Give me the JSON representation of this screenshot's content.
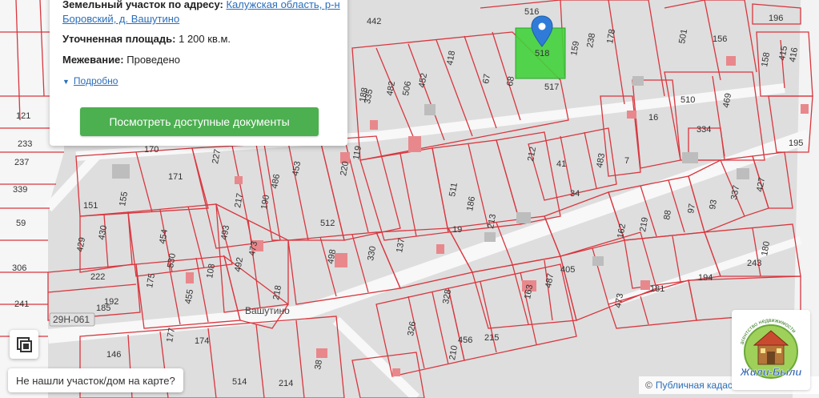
{
  "info": {
    "address_label": "Земельный участок по адресу:",
    "address_line1": "Калужская область, р-н",
    "address_line2": "Боровский, д. Вашутино",
    "area_label": "Уточненная площадь:",
    "area_value": "1 200 кв.м.",
    "survey_label": "Межевание:",
    "survey_value": "Проведено",
    "details_link": "Подробно",
    "docs_button": "Посмотреть доступные документы"
  },
  "map": {
    "selected_plot": "518",
    "road_code": "29Н-061",
    "village_label": "Вашутино",
    "plots": [
      "516",
      "442",
      "196",
      "159",
      "178",
      "238",
      "501",
      "156",
      "415",
      "158",
      "416",
      "67",
      "68",
      "517",
      "418",
      "452",
      "482",
      "506",
      "188",
      "335",
      "121",
      "233",
      "237",
      "339",
      "59",
      "306",
      "241",
      "510",
      "469",
      "334",
      "16",
      "195",
      "7",
      "170",
      "171",
      "227",
      "220",
      "119",
      "453",
      "486",
      "190",
      "217",
      "151",
      "155",
      "492",
      "430",
      "429",
      "454",
      "530",
      "222",
      "192",
      "185",
      "175",
      "108",
      "455",
      "493",
      "473",
      "218",
      "512",
      "498",
      "330",
      "137",
      "19",
      "511",
      "186",
      "213",
      "212",
      "41",
      "34",
      "483",
      "405",
      "487",
      "163",
      "162",
      "219",
      "88",
      "97",
      "93",
      "337",
      "427",
      "243",
      "180",
      "194",
      "181",
      "473",
      "326",
      "328",
      "456",
      "210",
      "215",
      "38",
      "174",
      "177",
      "146",
      "214",
      "514"
    ]
  },
  "controls": {
    "legend_icon": "map-legend-icon",
    "not_found_text": "Не нашли участок/дом на карте?"
  },
  "attribution": {
    "symbol": "©",
    "source": "Публичная кадас"
  },
  "agency": {
    "top_text": "агентство недвижимости",
    "name": "Жили-Были"
  },
  "colors": {
    "plot_border": "#d9363e",
    "selected_fill": "#43d13c",
    "pin": "#2f7cd8",
    "button_green": "#4caf50",
    "link": "#2a6ebb"
  }
}
